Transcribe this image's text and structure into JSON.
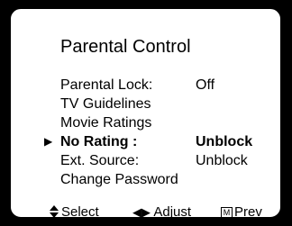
{
  "menu": {
    "title": "Parental Control",
    "items": [
      {
        "label": "Parental Lock:",
        "value": "Off"
      },
      {
        "label": "TV Guidelines",
        "value": ""
      },
      {
        "label": "Movie Ratings",
        "value": ""
      },
      {
        "label": "No Rating :",
        "value": "Unblock",
        "selected": true
      },
      {
        "label": "Ext. Source:",
        "value": "Unblock"
      },
      {
        "label": "Change Password",
        "value": ""
      }
    ]
  },
  "footer": {
    "select_icon": "up-down-arrows-icon",
    "select_label": "Select",
    "adjust_icon": "left-right-arrows-icon",
    "adjust_label": "Adjust",
    "prev_icon": "menu-box-icon",
    "prev_icon_glyph": "M",
    "prev_label": "Prev"
  },
  "pointer_icon": "right-triangle-pointer-icon",
  "colors": {
    "background": "#ffffff",
    "border": "#000000",
    "text": "#000000"
  }
}
